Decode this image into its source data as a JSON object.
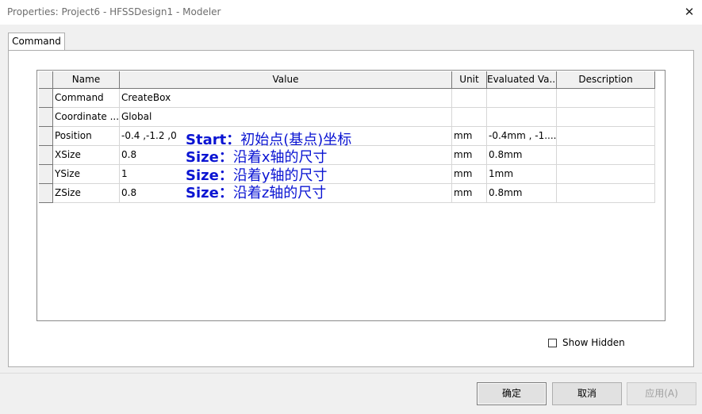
{
  "window": {
    "title": "Properties: Project6 - HFSSDesign1 - Modeler",
    "close_symbol": "✕"
  },
  "tabs": [
    {
      "label": "Command",
      "active": true
    }
  ],
  "table": {
    "headers": [
      "Name",
      "Value",
      "Unit",
      "Evaluated Va...",
      "Description"
    ],
    "rows": [
      {
        "name": "Command",
        "value": "CreateBox",
        "unit": "",
        "evaluated": "",
        "description": ""
      },
      {
        "name": "Coordinate ...",
        "value": "Global",
        "unit": "",
        "evaluated": "",
        "description": ""
      },
      {
        "name": "Position",
        "value": "-0.4 ,-1.2 ,0",
        "unit": "mm",
        "evaluated": "-0.4mm , -1....",
        "description": ""
      },
      {
        "name": "XSize",
        "value": "0.8",
        "unit": "mm",
        "evaluated": "0.8mm",
        "description": ""
      },
      {
        "name": "YSize",
        "value": "1",
        "unit": "mm",
        "evaluated": "1mm",
        "description": ""
      },
      {
        "name": "ZSize",
        "value": "0.8",
        "unit": "mm",
        "evaluated": "0.8mm",
        "description": ""
      }
    ]
  },
  "annotations": [
    {
      "key": "Start：",
      "text": "初始点(基点)坐标"
    },
    {
      "key": "Size：",
      "text": "沿着x轴的尺寸"
    },
    {
      "key": "Size：",
      "text": "沿着y轴的尺寸"
    },
    {
      "key": "Size：",
      "text": "沿着z轴的尺寸"
    }
  ],
  "show_hidden": {
    "label": "Show Hidden",
    "checked": false
  },
  "buttons": {
    "ok": "确定",
    "cancel": "取消",
    "apply": "应用(A)"
  },
  "colors": {
    "annotation": "#0a14d2"
  }
}
